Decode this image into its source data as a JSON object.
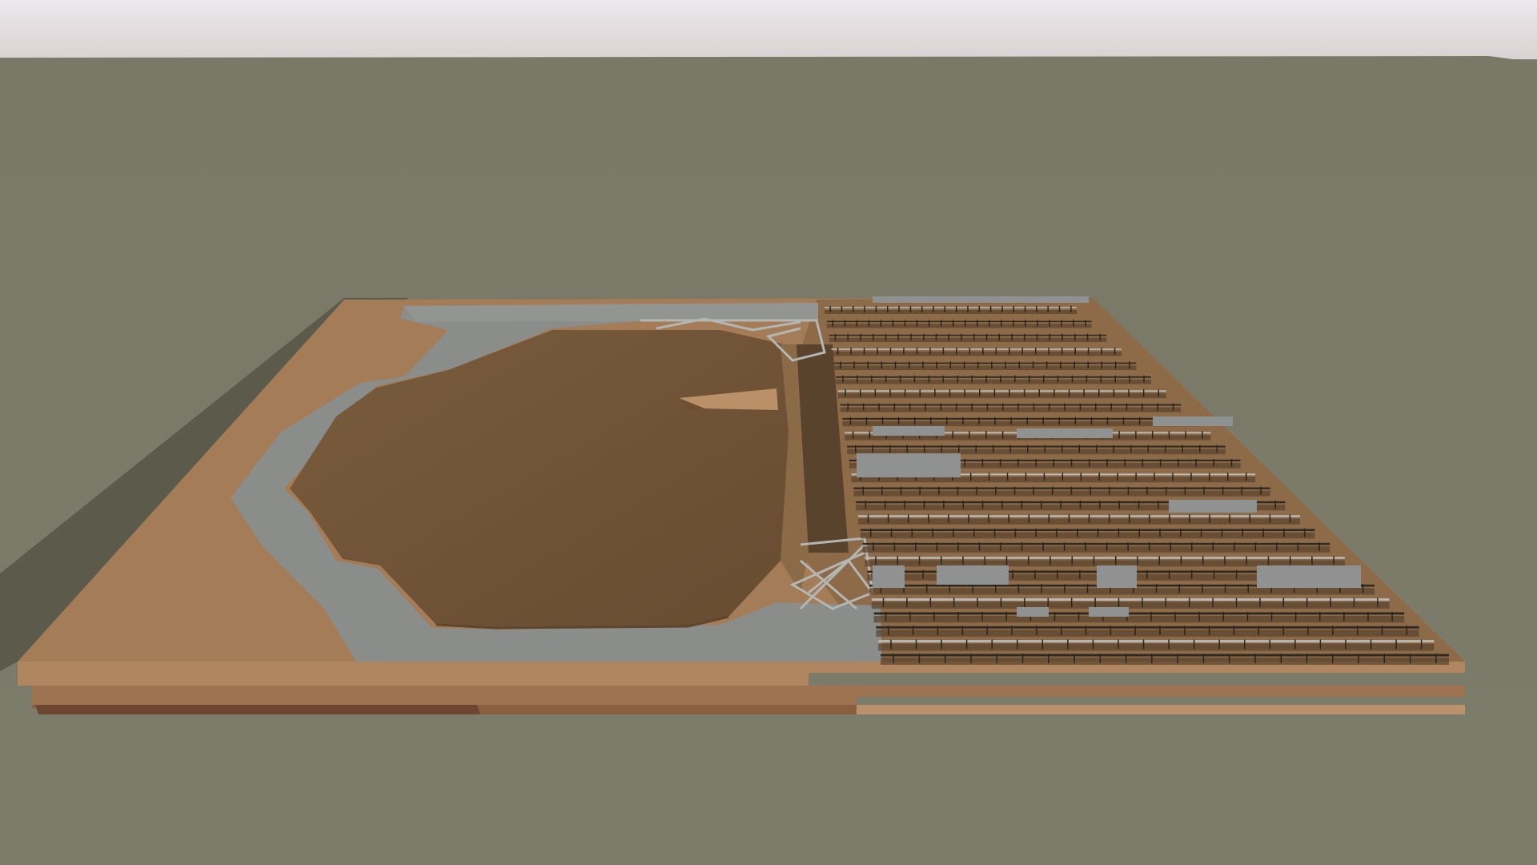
{
  "scene": {
    "kind": "3d-viewport",
    "colors": {
      "sky_top": "#ece8ec",
      "sky_horizon": "#d9d2d2",
      "ground": "#7b7a68",
      "terrain_top": "#a47d59",
      "terrain_dark": "#6f5438",
      "pit_floor": "#6e5236",
      "road": "#8d8f8d",
      "road_dark": "#6e706e",
      "shadow": "#5a5a4a",
      "side_light": "#b08661",
      "side_mid": "#9c7452",
      "side_dark": "#6a4530"
    },
    "objects": [
      {
        "name": "terrain-block"
      },
      {
        "name": "excavation-pit"
      },
      {
        "name": "haul-road"
      },
      {
        "name": "ramp"
      },
      {
        "name": "support-structures"
      }
    ]
  }
}
